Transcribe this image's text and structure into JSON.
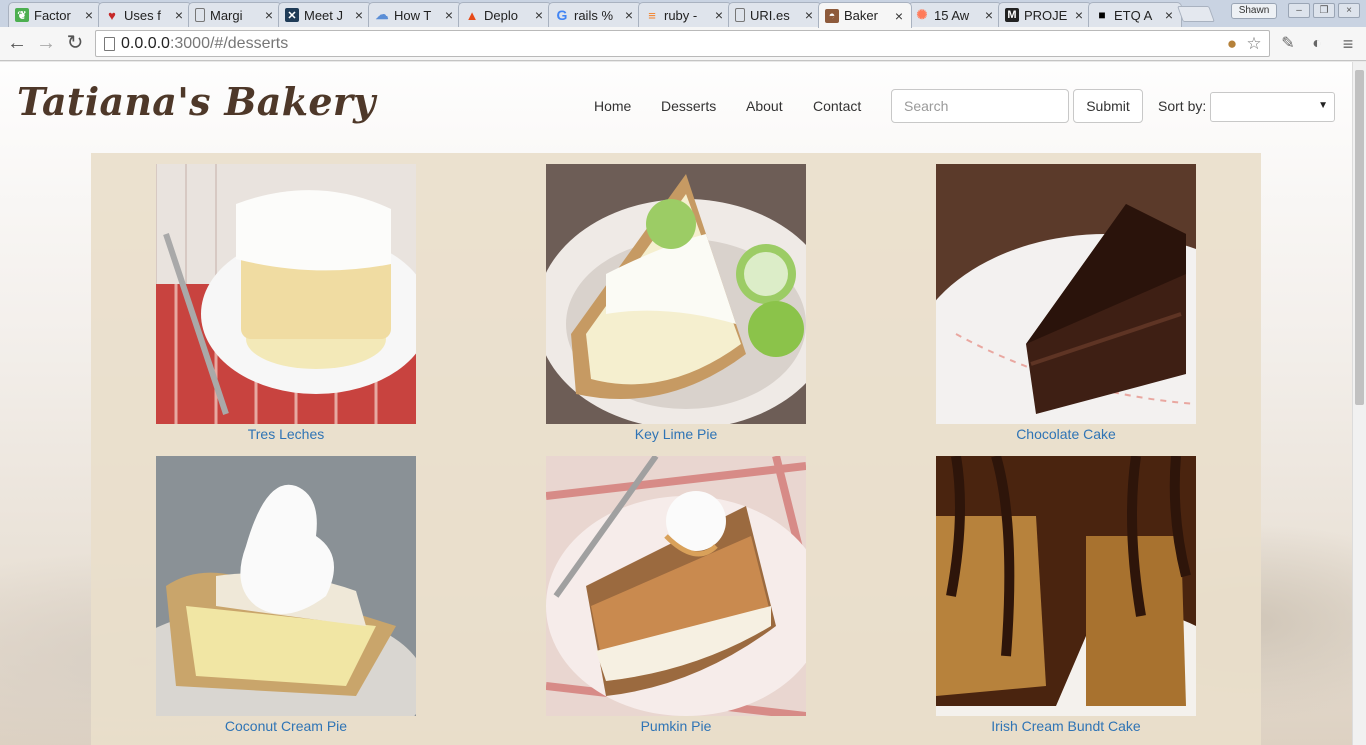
{
  "browser": {
    "tabs": [
      {
        "title": "Factor",
        "favicon": "leaf-icon",
        "color": "#4caf50"
      },
      {
        "title": "Uses f",
        "favicon": "heart-icon",
        "color": "#c62828"
      },
      {
        "title": "Margi",
        "favicon": "page-icon",
        "color": "#9e9e9e"
      },
      {
        "title": "Meet J",
        "favicon": "x-logo-icon",
        "color": "#1f3b57"
      },
      {
        "title": "How T",
        "favicon": "cloud-icon",
        "color": "#5b8ed6"
      },
      {
        "title": "Deplo",
        "favicon": "triangle-icon",
        "color": "#e64a19"
      },
      {
        "title": "rails %",
        "favicon": "google-icon",
        "color": "#4285f4"
      },
      {
        "title": "ruby -",
        "favicon": "stack-icon",
        "color": "#f48024"
      },
      {
        "title": "URI.es",
        "favicon": "page-icon",
        "color": "#9e9e9e"
      },
      {
        "title": "Baker",
        "favicon": "cake-icon",
        "color": "#8d5a3b",
        "active": true
      },
      {
        "title": "15 Aw",
        "favicon": "hubspot-icon",
        "color": "#ff7a59"
      },
      {
        "title": "PROJE",
        "favicon": "m-logo-icon",
        "color": "#222222"
      },
      {
        "title": "ETQ A",
        "favicon": "square-icon",
        "color": "#000000"
      }
    ],
    "profile_name": "Shawn",
    "url_host": "0.0.0.0",
    "url_rest": ":3000/#/desserts"
  },
  "site": {
    "brand": "Tatiana's Bakery",
    "nav": [
      "Home",
      "Desserts",
      "About",
      "Contact"
    ],
    "search_placeholder": "Search",
    "submit_label": "Submit",
    "sort_label": "Sort by:",
    "sort_value": ""
  },
  "desserts": [
    {
      "name": "Tres Leches",
      "image": "tres-leches-image"
    },
    {
      "name": "Key Lime Pie",
      "image": "key-lime-pie-image"
    },
    {
      "name": "Chocolate Cake",
      "image": "chocolate-cake-image"
    },
    {
      "name": "Coconut Cream Pie",
      "image": "coconut-cream-pie-image"
    },
    {
      "name": "Pumkin Pie",
      "image": "pumpkin-pie-image"
    },
    {
      "name": "Irish Cream Bundt Cake",
      "image": "bundt-cake-image"
    }
  ],
  "colors": {
    "brand": "#4e3829",
    "link": "#2f74b5",
    "gallery_bg": "#e9decb"
  }
}
